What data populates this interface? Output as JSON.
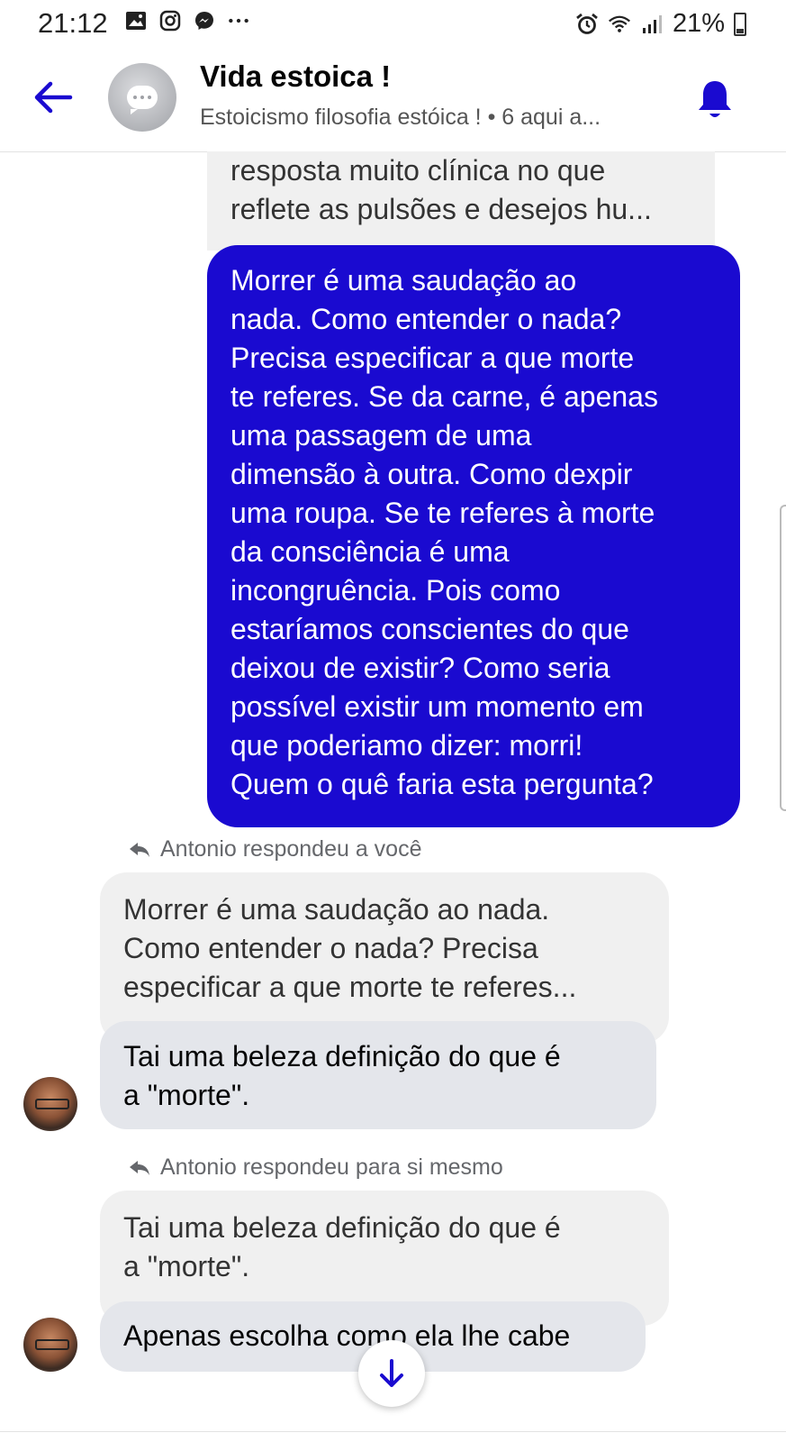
{
  "status_bar": {
    "time": "21:12",
    "battery": "21%",
    "icons_left": [
      "gallery-icon",
      "instagram-icon",
      "messenger-icon",
      "more-icon"
    ],
    "icons_right": [
      "alarm-icon",
      "wifi-icon",
      "signal-icon",
      "battery-icon"
    ]
  },
  "header": {
    "title": "Vida estoica !",
    "subtitle": "Estoicismo  filosofia estóica ! • 6 aqui a..."
  },
  "messages": {
    "quoted_top": "resposta muito clínica no que\nreflete as pulsões  e desejos hu...",
    "mine": "Morrer é uma saudação ao\nnada. Como entender o nada?\nPrecisa especificar a que morte\nte referes. Se da carne, é apenas\numa passagem de uma\ndimensão à outra. Como dexpir\numa roupa. Se te referes à morte\nda consciência é uma\nincongruência.  Pois como\nestaríamos conscientes do que\ndeixou de existir? Como seria\npossível existir um momento em\nque poderiamo dizer: morri!\nQuem o quê faria esta pergunta?",
    "reply1_label": "Antonio respondeu a você",
    "reply1_quoted": "Morrer é uma saudação ao nada.\nComo entender o nada? Precisa\nespecificar a que morte te referes...",
    "reply1_text": "Tai uma beleza definição do que é\na \"morte\".",
    "reply2_label": "Antonio respondeu para si mesmo",
    "reply2_quoted": "Tai uma beleza definição do que é\na \"morte\".",
    "reply2_text": "Apenas escolha como ela lhe cabe"
  },
  "colors": {
    "accent": "#1a0ad0",
    "incoming_bubble": "#e4e6eb",
    "quoted_bubble": "#f0f0f0"
  }
}
